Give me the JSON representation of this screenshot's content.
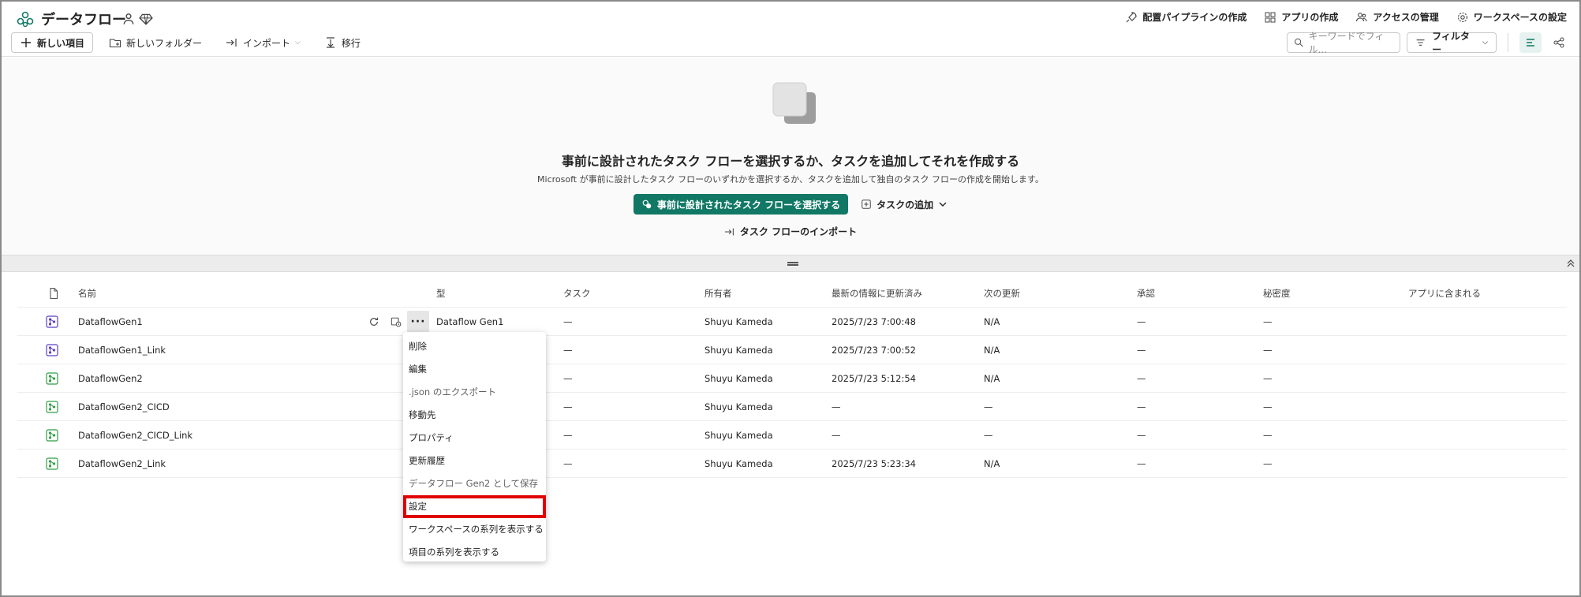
{
  "workspace": {
    "title": "データフロー"
  },
  "top_actions": [
    {
      "label": "配置パイプラインの作成",
      "icon": "rocket-icon"
    },
    {
      "label": "アプリの作成",
      "icon": "app-grid-icon"
    },
    {
      "label": "アクセスの管理",
      "icon": "people-icon"
    },
    {
      "label": "ワークスペースの設定",
      "icon": "gear-icon"
    }
  ],
  "toolbar": {
    "new_item": "新しい項目",
    "new_folder": "新しいフォルダー",
    "import": "インポート",
    "migrate": "移行"
  },
  "search": {
    "placeholder": "キーワードでフィル..."
  },
  "filter": {
    "label": "フィルター"
  },
  "hero": {
    "title": "事前に設計されたタスク フローを選択するか、タスクを追加してそれを作成する",
    "subtitle": "Microsoft が事前に設計したタスク フローのいずれかを選択するか、タスクを追加して独自のタスク フローの作成を開始します。",
    "primary_label": "事前に設計されたタスク フローを選択する",
    "add_task_label": "タスクの追加",
    "import_label": "タスク フローのインポート"
  },
  "table": {
    "headers": {
      "name": "名前",
      "type": "型",
      "task": "タスク",
      "owner": "所有者",
      "refreshed": "最新の情報に更新済み",
      "next": "次の更新",
      "endorse": "承認",
      "sensitivity": "秘密度",
      "in_app": "アプリに含まれる"
    },
    "rows": [
      {
        "name": "DataflowGen1",
        "type": "Dataflow Gen1",
        "task": "—",
        "owner": "Shuyu Kameda",
        "refreshed": "2025/7/23 7:00:48",
        "next": "N/A",
        "endorse": "—",
        "sensitivity": "—",
        "in_app": ""
      },
      {
        "name": "DataflowGen1_Link",
        "type": "",
        "task": "—",
        "owner": "Shuyu Kameda",
        "refreshed": "2025/7/23 7:00:52",
        "next": "N/A",
        "endorse": "—",
        "sensitivity": "—",
        "in_app": ""
      },
      {
        "name": "DataflowGen2",
        "type": "",
        "task": "—",
        "owner": "Shuyu Kameda",
        "refreshed": "2025/7/23 5:12:54",
        "next": "N/A",
        "endorse": "—",
        "sensitivity": "—",
        "in_app": ""
      },
      {
        "name": "DataflowGen2_CICD",
        "type": "",
        "task": "—",
        "owner": "Shuyu Kameda",
        "refreshed": "—",
        "next": "—",
        "endorse": "—",
        "sensitivity": "—",
        "in_app": ""
      },
      {
        "name": "DataflowGen2_CICD_Link",
        "type": "",
        "task": "—",
        "owner": "Shuyu Kameda",
        "refreshed": "—",
        "next": "—",
        "endorse": "—",
        "sensitivity": "—",
        "in_app": ""
      },
      {
        "name": "DataflowGen2_Link",
        "type": "",
        "task": "—",
        "owner": "Shuyu Kameda",
        "refreshed": "2025/7/23 5:23:34",
        "next": "N/A",
        "endorse": "—",
        "sensitivity": "—",
        "in_app": ""
      }
    ]
  },
  "context_menu": {
    "items": [
      {
        "label": "削除"
      },
      {
        "label": "編集"
      },
      {
        "label": ".json のエクスポート"
      },
      {
        "label": "移動先"
      },
      {
        "label": "プロパティ"
      },
      {
        "label": "更新履歴"
      },
      {
        "label": "データフロー Gen2 として保存"
      },
      {
        "label": "設定"
      },
      {
        "label": "ワークスペースの系列を表示する"
      },
      {
        "label": "項目の系列を表示する"
      }
    ],
    "highlighted": "設定"
  },
  "colors": {
    "accent": "#117865",
    "gen1_icon": "#5b3fc4",
    "gen2_icon": "#2f9e44",
    "highlight": "#e00000"
  }
}
